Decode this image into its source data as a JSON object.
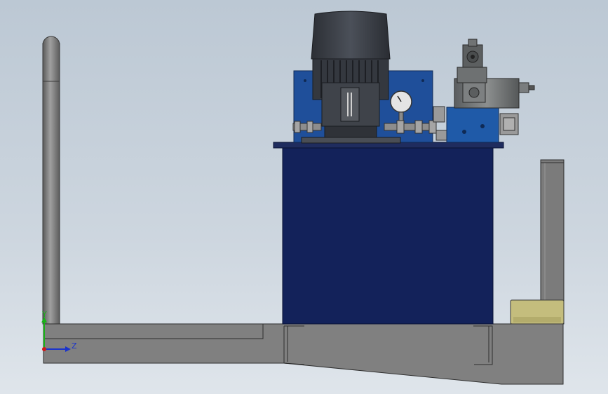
{
  "viewport": {
    "background_top": "#bcc8d4",
    "background_bottom": "#dfe5eb"
  },
  "triad": {
    "y_label": "Y",
    "z_label": "Z",
    "y_color": "#19b319",
    "z_color": "#1a33cc",
    "x_color": "#cc1a1a"
  },
  "model": {
    "motor_color": "#3b3f46",
    "tank_color": "#13225a",
    "panel_color": "#1f4f9a",
    "valve_block_color": "#1f5aa8",
    "frame_color": "#808080",
    "pad_color": "#c4bd7d"
  }
}
